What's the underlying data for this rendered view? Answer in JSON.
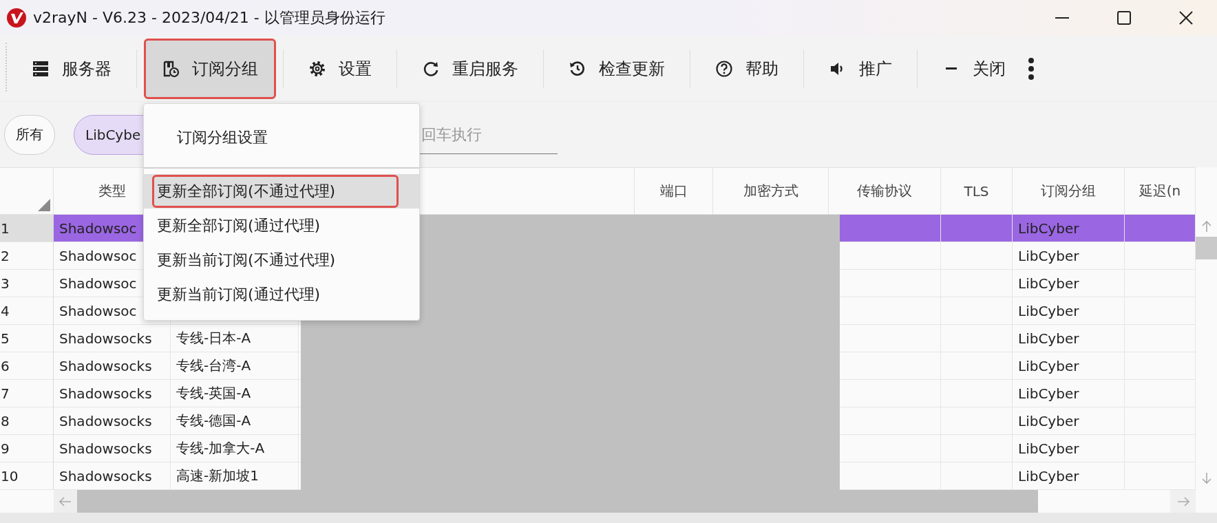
{
  "window": {
    "title": "v2rayN - V6.23 - 2023/04/21 - 以管理员身份运行"
  },
  "toolbar": [
    {
      "label": "服务器",
      "selected": false,
      "annotated": false
    },
    {
      "label": "订阅分组",
      "selected": true,
      "annotated": true
    },
    {
      "label": "设置",
      "selected": false,
      "annotated": false
    },
    {
      "label": "重启服务",
      "selected": false,
      "annotated": false
    },
    {
      "label": "检查更新",
      "selected": false,
      "annotated": false
    },
    {
      "label": "帮助",
      "selected": false,
      "annotated": false
    },
    {
      "label": "推广",
      "selected": false,
      "annotated": false
    },
    {
      "label": "关闭",
      "selected": false,
      "annotated": false
    }
  ],
  "filters": {
    "chips": [
      {
        "label": "所有",
        "selected": false
      },
      {
        "label": "LibCybe",
        "selected": true
      }
    ],
    "search": {
      "placeholder": "回车执行"
    }
  },
  "menu": {
    "items": [
      {
        "kind": "settings",
        "label": "订阅分组设置",
        "hovered": false,
        "annotated": false
      },
      {
        "kind": "separator"
      },
      {
        "kind": "action",
        "label": "更新全部订阅(不通过代理)",
        "hovered": true,
        "annotated": true
      },
      {
        "kind": "action",
        "label": "更新全部订阅(通过代理)",
        "hovered": false,
        "annotated": false
      },
      {
        "kind": "action",
        "label": "更新当前订阅(不通过代理)",
        "hovered": false,
        "annotated": false
      },
      {
        "kind": "action",
        "label": "更新当前订阅(通过代理)",
        "hovered": false,
        "annotated": false
      }
    ]
  },
  "table": {
    "columns": [
      "类型",
      "端口",
      "加密方式",
      "传输协议",
      "TLS",
      "订阅分组",
      "延迟(n"
    ],
    "rows": [
      {
        "number": "1",
        "type": "Shadowsoc",
        "group": "LibCyber",
        "selected": true
      },
      {
        "number": "2",
        "type": "Shadowsoc",
        "group": "LibCyber",
        "selected": false
      },
      {
        "number": "3",
        "type": "Shadowsoc",
        "group": "LibCyber",
        "selected": false
      },
      {
        "number": "4",
        "type": "Shadowsoc",
        "group": "LibCyber",
        "selected": false
      },
      {
        "number": "5",
        "type": "Shadowsocks",
        "alias": "专线-日本-A",
        "group": "LibCyber",
        "selected": false
      },
      {
        "number": "6",
        "type": "Shadowsocks",
        "alias": "专线-台湾-A",
        "group": "LibCyber",
        "selected": false
      },
      {
        "number": "7",
        "type": "Shadowsocks",
        "alias": "专线-英国-A",
        "group": "LibCyber",
        "selected": false
      },
      {
        "number": "8",
        "type": "Shadowsocks",
        "alias": "专线-德国-A",
        "group": "LibCyber",
        "selected": false
      },
      {
        "number": "9",
        "type": "Shadowsocks",
        "alias": "专线-加拿大-A",
        "group": "LibCyber",
        "selected": false
      },
      {
        "number": "10",
        "type": "Shadowsocks",
        "alias": "高速-新加坡1",
        "group": "LibCyber",
        "selected": false
      }
    ]
  }
}
